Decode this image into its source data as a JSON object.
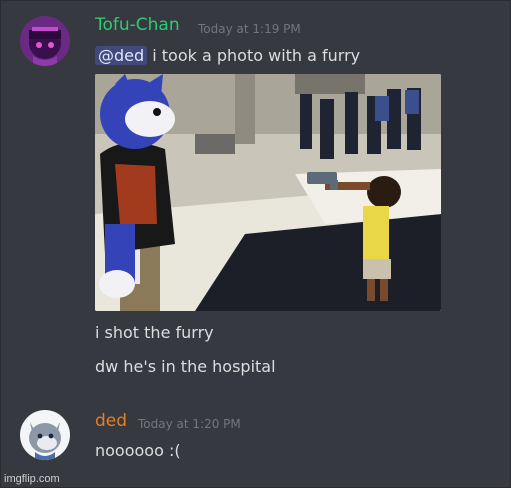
{
  "messages": [
    {
      "username": "Tofu-Chan",
      "username_color": "#2ecc71",
      "timestamp": "Today at 1:19 PM",
      "mention": "@ded",
      "line1": "i took a photo with a furry",
      "line2": "i shot the furry",
      "line3": "dw he's in the hospital"
    },
    {
      "username": "ded",
      "username_color": "#e67e22",
      "timestamp": "Today at 1:20 PM",
      "line1": "noooooo :("
    }
  ],
  "watermark": "imgflip.com"
}
